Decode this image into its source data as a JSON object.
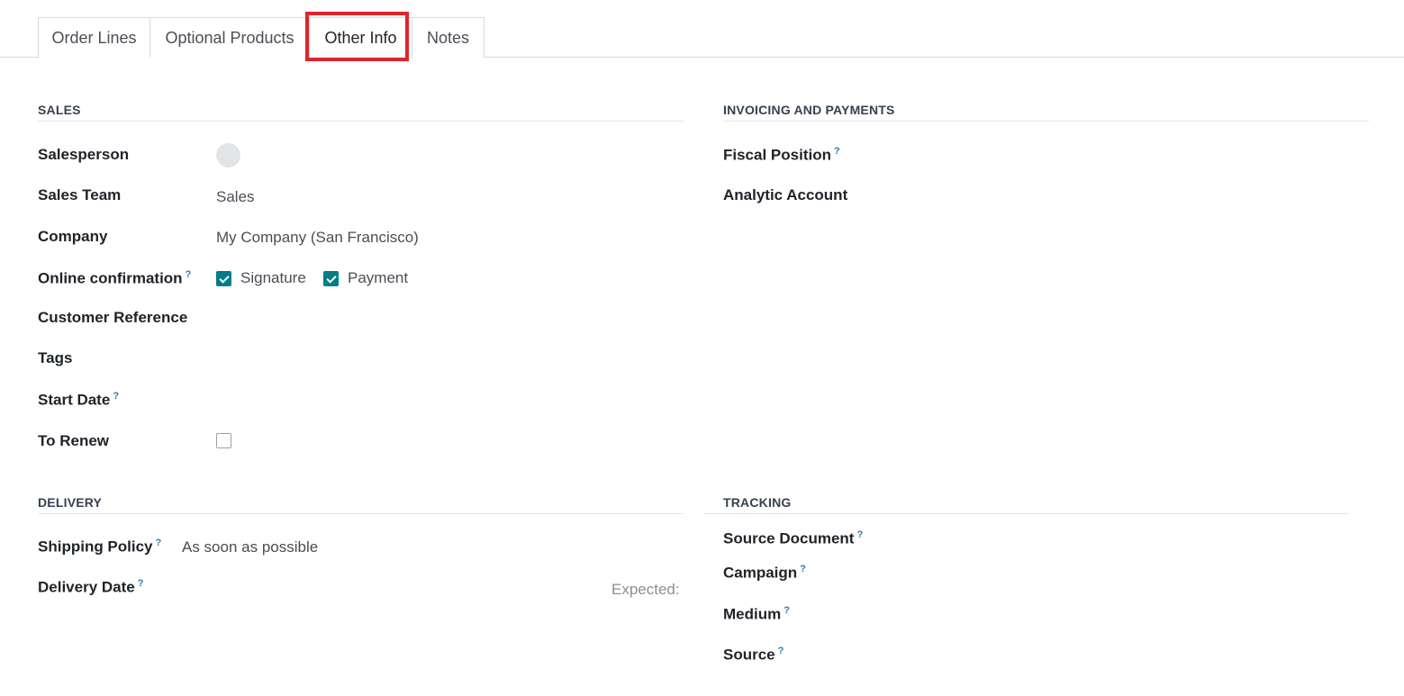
{
  "tabs": [
    {
      "label": "Order Lines"
    },
    {
      "label": "Optional Products"
    },
    {
      "label": "Other Info"
    },
    {
      "label": "Notes"
    }
  ],
  "sections": {
    "sales": {
      "title": "SALES",
      "salesperson_label": "Salesperson",
      "sales_team_label": "Sales Team",
      "sales_team_value": "Sales",
      "company_label": "Company",
      "company_value": "My Company (San Francisco)",
      "online_confirmation_label": "Online confirmation",
      "signature_label": "Signature",
      "payment_label": "Payment",
      "customer_reference_label": "Customer Reference",
      "tags_label": "Tags",
      "start_date_label": "Start Date",
      "to_renew_label": "To Renew"
    },
    "invoicing": {
      "title": "INVOICING AND PAYMENTS",
      "fiscal_position_label": "Fiscal Position",
      "analytic_account_label": "Analytic Account"
    },
    "delivery": {
      "title": "DELIVERY",
      "shipping_policy_label": "Shipping Policy",
      "shipping_policy_value": "As soon as possible",
      "delivery_date_label": "Delivery Date",
      "expected_label": "Expected:"
    },
    "tracking": {
      "title": "TRACKING",
      "source_document_label": "Source Document",
      "campaign_label": "Campaign",
      "medium_label": "Medium",
      "source_label": "Source"
    }
  },
  "help_marker": "?",
  "checkbox_states": {
    "signature": true,
    "payment": true,
    "to_renew": false
  },
  "colors": {
    "accent": "#017e84",
    "highlight": "#e0242c",
    "help": "#2a7ea8"
  }
}
